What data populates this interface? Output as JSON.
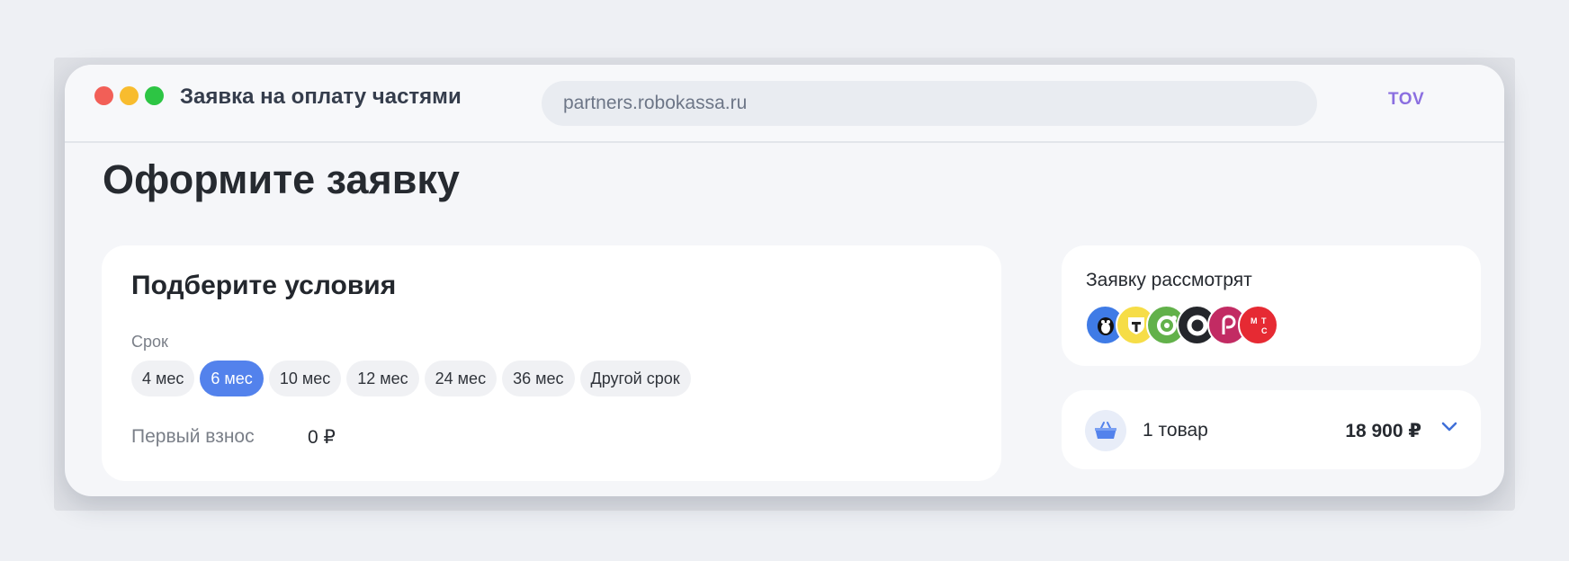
{
  "window": {
    "title": "Заявка на оплату частями",
    "url": "partners.robokassa.ru",
    "account": "TOV"
  },
  "page": {
    "title": "Оформите заявку"
  },
  "conditions": {
    "title": "Подберите условия",
    "term_label": "Срок",
    "terms": [
      "4 мес",
      "6 мес",
      "10 мес",
      "12 мес",
      "24 мес",
      "36 мес",
      "Другой срок"
    ],
    "selected_term": "6 мес",
    "down_payment_label": "Первый взнос",
    "down_payment_value": "0 ₽"
  },
  "review": {
    "title": "Заявку рассмотрят",
    "lenders": [
      {
        "icon": "penguin-icon",
        "color": "#3f7be6"
      },
      {
        "icon": "tbank-icon",
        "color": "#f6dd47"
      },
      {
        "icon": "otp-icon",
        "color": "#62b14a"
      },
      {
        "icon": "ring-icon",
        "color": "#24262b"
      },
      {
        "icon": "p-icon",
        "color": "#c22b63"
      },
      {
        "icon": "mts-icon",
        "color": "#e62a33"
      }
    ]
  },
  "cart": {
    "count_text": "1 товар",
    "total": "18 900 ₽"
  },
  "colors": {
    "accent": "#5382ec",
    "account": "#8b6fe0"
  }
}
